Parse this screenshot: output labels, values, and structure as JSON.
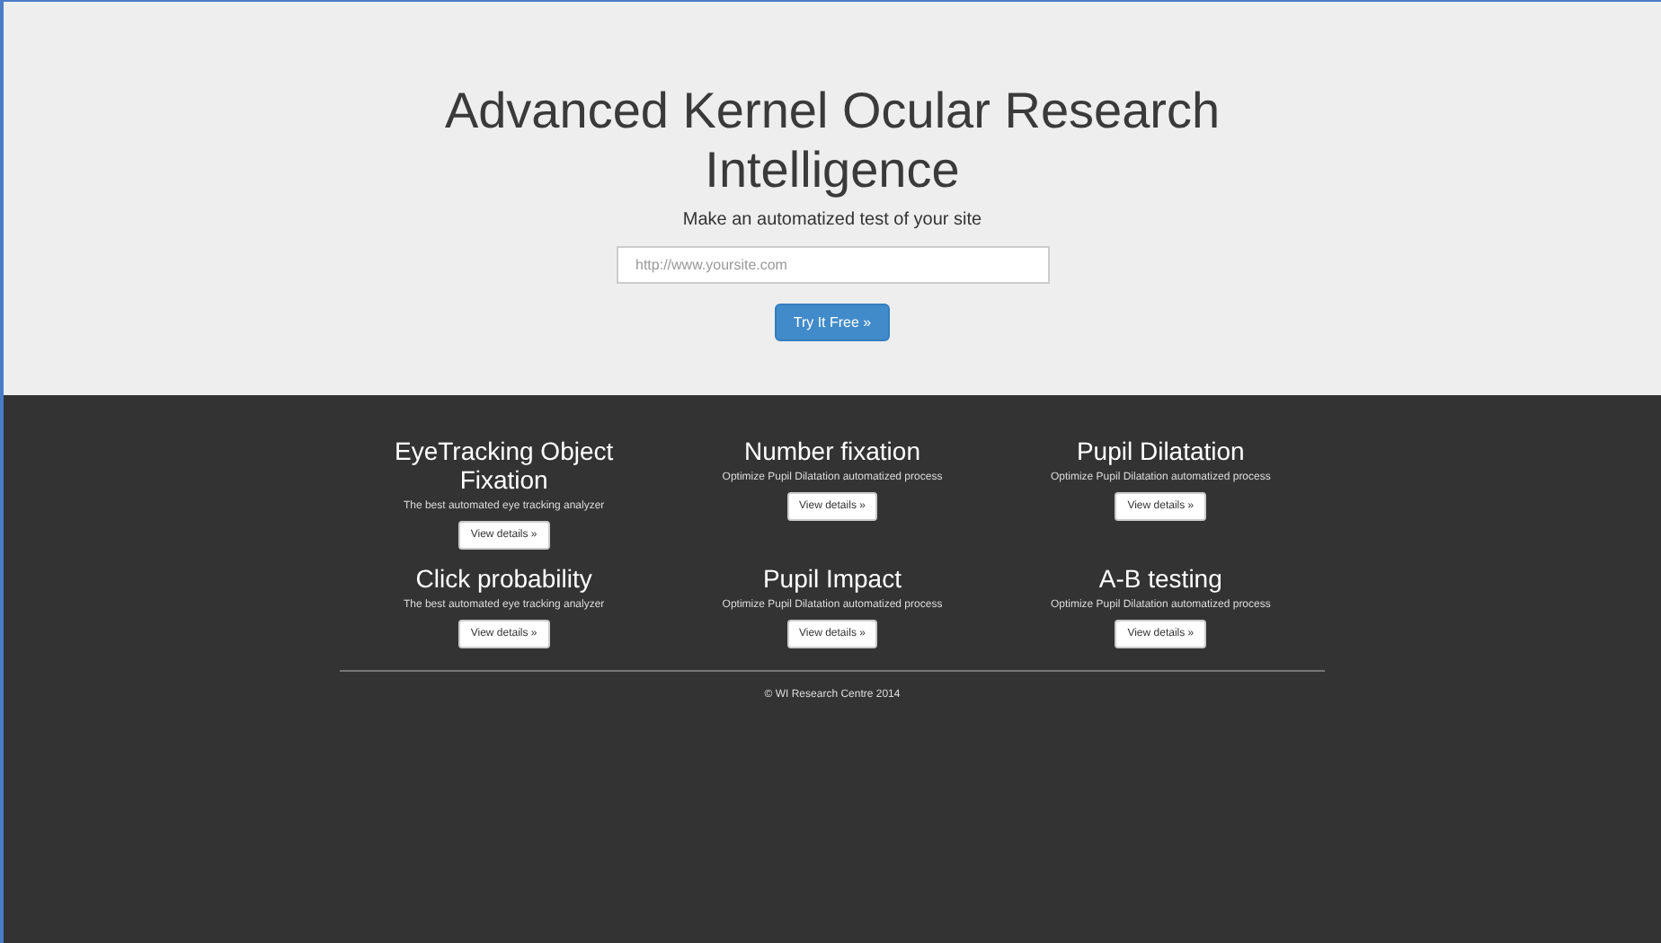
{
  "hero": {
    "title": "Advanced Kernel Ocular Research Intelligence",
    "subtitle": "Make an automatized test of your site",
    "url_field": {
      "placeholder": "http://www.yoursite.com"
    },
    "button": "Try It Free »"
  },
  "features": [
    {
      "title": "EyeTracking Object Fixation",
      "text": "The best automated eye tracking analyzer",
      "button": "View details »"
    },
    {
      "title": "Number fixation",
      "text": "Optimize Pupil Dilatation automatized process",
      "button": "View details »"
    },
    {
      "title": "Pupil Dilatation",
      "text": "Optimize Pupil Dilatation automatized process",
      "button": "View details »"
    },
    {
      "title": "Click probability",
      "text": "The best automated eye tracking analyzer",
      "button": "View details »"
    },
    {
      "title": "Pupil Impact",
      "text": "Optimize Pupil Dilatation automatized process",
      "button": "View details »"
    },
    {
      "title": "A-B testing",
      "text": "Optimize Pupil Dilatation automatized process",
      "button": "View details »"
    }
  ],
  "footer": "© WI Research Centre 2014"
}
